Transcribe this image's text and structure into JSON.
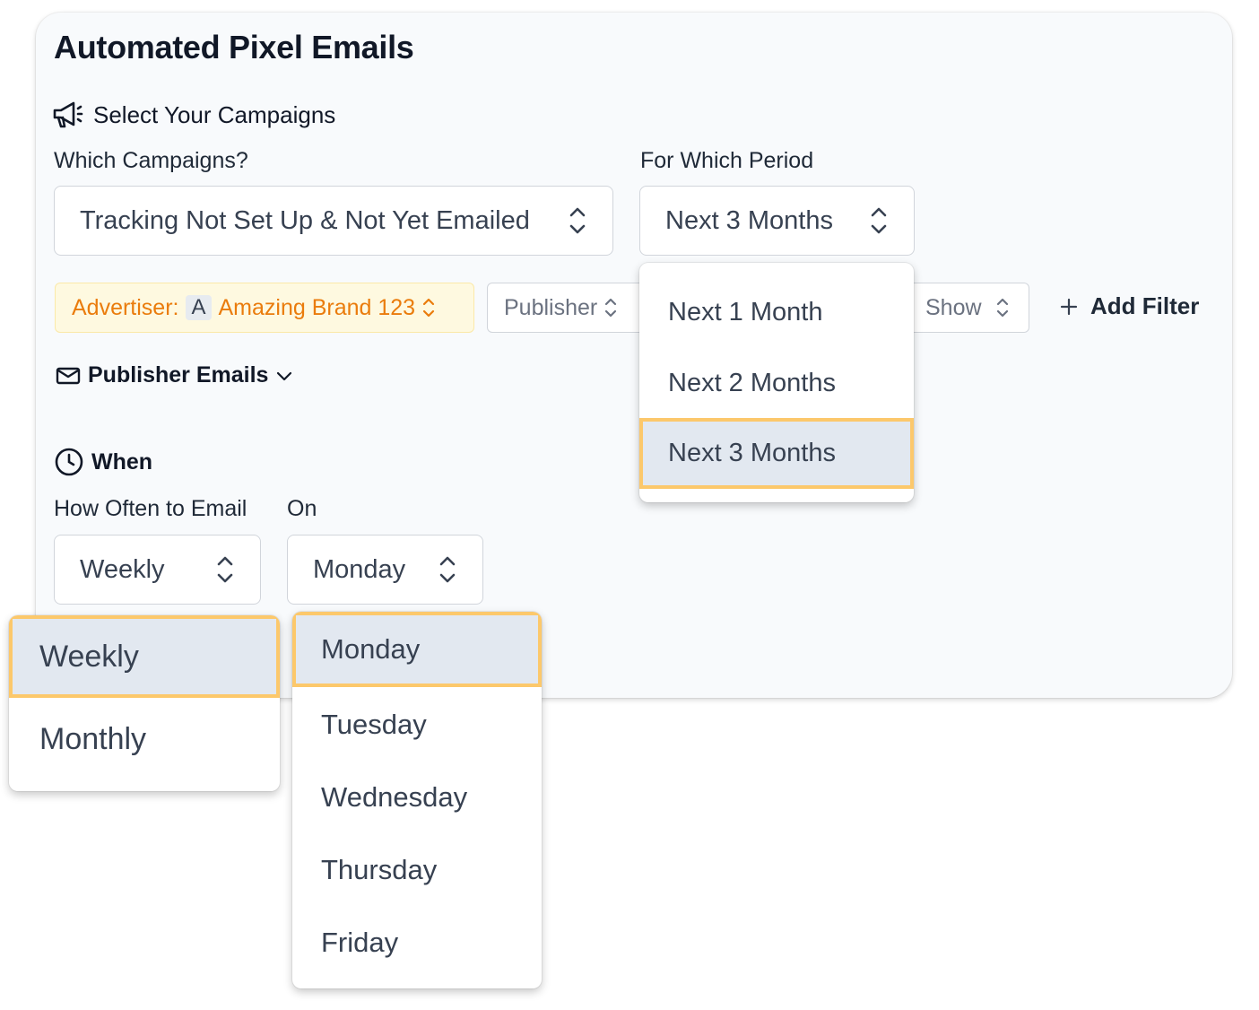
{
  "title": "Automated Pixel Emails",
  "campaigns_section": {
    "heading": "Select Your Campaigns",
    "icon": "megaphone-icon"
  },
  "which_campaigns": {
    "label": "Which Campaigns?",
    "value": "Tracking Not Set Up & Not Yet Emailed"
  },
  "period": {
    "label": "For Which Period",
    "value": "Next 3 Months",
    "options": [
      "Next 1 Month",
      "Next 2 Months",
      "Next 3 Months"
    ],
    "selected_index": 2
  },
  "filters": {
    "advertiser_label": "Advertiser:",
    "advertiser_badge": "A",
    "advertiser_value": "Amazing Brand 123",
    "publisher": "Publisher",
    "show": "Show",
    "add_filter": "Add Filter"
  },
  "publisher_emails": {
    "label": "Publisher Emails",
    "icon": "mail-icon"
  },
  "when_section": {
    "heading": "When",
    "icon": "clock-icon"
  },
  "frequency": {
    "label": "How Often to Email",
    "value": "Weekly",
    "options": [
      "Weekly",
      "Monthly"
    ],
    "selected_index": 0
  },
  "day": {
    "label": "On",
    "value": "Monday",
    "options": [
      "Monday",
      "Tuesday",
      "Wednesday",
      "Thursday",
      "Friday"
    ],
    "selected_index": 0
  },
  "colors": {
    "highlight_border": "#fcc86b",
    "selected_bg": "#e2e8f0",
    "advertiser_text": "#ea7c0c",
    "advertiser_bg": "#fef9e0"
  }
}
